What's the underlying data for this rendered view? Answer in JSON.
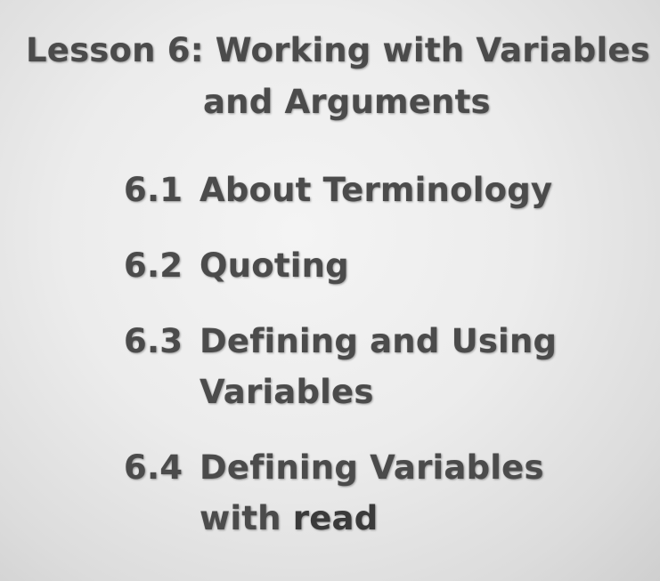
{
  "slide": {
    "title_prefix": "Lesson 6:",
    "title_line1": "Working with Variables",
    "title_line2": "and Arguments",
    "items": [
      {
        "number": "6.1",
        "text": "About Terminology"
      },
      {
        "number": "6.2",
        "text": "Quoting"
      },
      {
        "number": "6.3",
        "line1": "Defining and Using",
        "line2": "Variables"
      },
      {
        "number": "6.4",
        "line1": "Defining Variables",
        "line2_prefix": "with",
        "line2_keyword": "read"
      }
    ]
  },
  "colors": {
    "text": "#4b4b4b",
    "background": "#ececec"
  }
}
